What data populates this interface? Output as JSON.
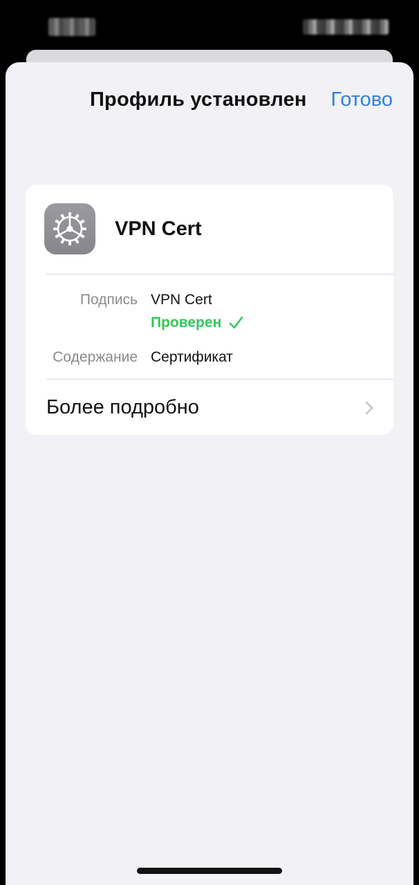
{
  "status_bar": {
    "time_icon": "blurred-time",
    "indicators_icon": "blurred-status-icons"
  },
  "header": {
    "title": "Профиль установлен",
    "done_label": "Готово"
  },
  "profile": {
    "icon": "settings-gear-icon",
    "name": "VPN Cert",
    "signature_label": "Подпись",
    "signature_value": "VPN Cert",
    "verified_label": "Проверен",
    "verified_icon": "checkmark-icon",
    "contents_label": "Содержание",
    "contents_value": "Сертификат",
    "more_details_label": "Более подробно",
    "more_details_icon": "chevron-right-icon"
  },
  "colors": {
    "accent": "#2d7fe3",
    "verified": "#34c759",
    "sheet_background": "#f1f1f6",
    "card_background": "#ffffff",
    "secondary_text": "#8a8a8e"
  }
}
